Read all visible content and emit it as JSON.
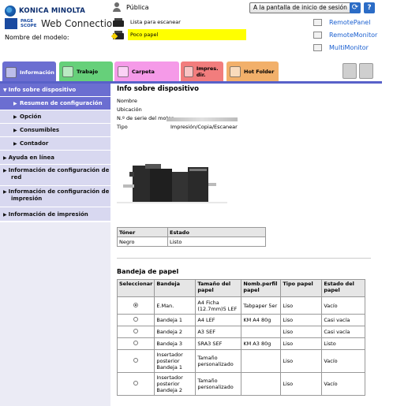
{
  "header": {
    "brand": "KONICA MINOLTA",
    "pagescope": "PAGE SCOPE",
    "product": "Web Connection",
    "model_label": "Nombre del modelo:",
    "user": "Pública",
    "status_1": "Lista para escanear",
    "status_2": "Poco papel",
    "login_button": "A la pantalla de inicio de sesión",
    "links": [
      "RemotePanel",
      "RemoteMonitor",
      "MultiMonitor"
    ]
  },
  "tabs": [
    {
      "label": "Información",
      "color": "#6b6ed1"
    },
    {
      "label": "Trabajo",
      "color": "#66d07a"
    },
    {
      "label": "Carpeta",
      "color": "#f59ae8"
    },
    {
      "label": "Impres. dir.",
      "color": "#f27d7d"
    },
    {
      "label": "Hot Folder",
      "color": "#f2b06a"
    }
  ],
  "sidebar": {
    "top": "Info sobre dispositivo",
    "sub": [
      "Resumen de configuración",
      "Opción",
      "Consumibles",
      "Contador"
    ],
    "other": [
      "Ayuda en línea",
      "Información de configuración de red",
      "Información de configuración de impresión",
      "Información de impresión"
    ]
  },
  "main": {
    "title": "Info sobre dispositivo",
    "rows": [
      {
        "key": "Nombre",
        "val": ""
      },
      {
        "key": "Ubicación",
        "val": ""
      },
      {
        "key": "N.º de serie del motor",
        "val": ""
      },
      {
        "key": "Tipo",
        "val": "Impresión/Copia/Escanear"
      }
    ],
    "toner": {
      "headers": [
        "Tóner",
        "Estado"
      ],
      "rows": [
        [
          "Negro",
          "Listo"
        ]
      ]
    },
    "tray_title": "Bandeja de papel",
    "tray": {
      "headers": [
        "Seleccionar",
        "Bandeja",
        "Tamaño del papel",
        "Nomb.perfil papel",
        "Tipo papel",
        "Estado del papel"
      ],
      "rows": [
        [
          "",
          "E.Man.",
          "A4 Ficha (12.7mm)5 LEF",
          "Tabpaper 5er",
          "Liso",
          "Vacío"
        ],
        [
          "",
          "Bandeja 1",
          "A4 LEF",
          "KM A4 80g",
          "Liso",
          "Casi vacía"
        ],
        [
          "",
          "Bandeja 2",
          "A3 SEF",
          "",
          "Liso",
          "Casi vacía"
        ],
        [
          "",
          "Bandeja 3",
          "SRA3 SEF",
          "KM A3 80g",
          "Liso",
          "Listo"
        ],
        [
          "",
          "Insertador posterior Bandeja 1",
          "Tamaño personalizado",
          "",
          "Liso",
          "Vacío"
        ],
        [
          "",
          "Insertador posterior Bandeja 2",
          "Tamaño personalizado",
          "",
          "Liso",
          "Vacío"
        ]
      ],
      "selected_index": 0
    }
  },
  "colors": {
    "accent": "#6b6ed1",
    "sidebar_sub": "#d8d8f0",
    "warning": "#ffff00",
    "link": "#1a5fd0"
  }
}
